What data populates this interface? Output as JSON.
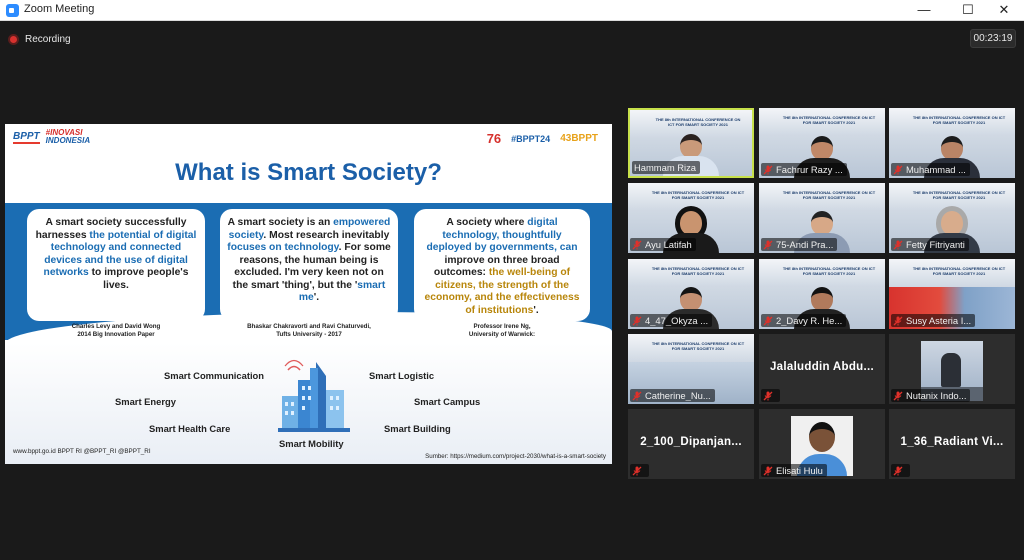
{
  "window": {
    "title": "Zoom Meeting",
    "controls": {
      "minimize": "—",
      "maximize": "☐",
      "close": "✕"
    }
  },
  "meeting": {
    "recording_label": "Recording",
    "elapsed": "00:23:19"
  },
  "slide": {
    "logo_bppt": "BPPT",
    "logo_inovasi_line1": "#INOVASI",
    "logo_inovasi_line2": "INDONESIA",
    "logo_76": "76",
    "logo_bppt24": "#BPPT24",
    "logo_43": "43BPPT",
    "title": "What is Smart Society?",
    "cards": [
      {
        "parts": [
          {
            "t": "A smart society successfully harnesses ",
            "c": ""
          },
          {
            "t": "the potential of digital technology and connected devices and the use of digital networks",
            "c": "hl"
          },
          {
            "t": " to improve people's lives.",
            "c": ""
          }
        ],
        "citation": [
          "Charles Levy and David Wong",
          "2014 Big Innovation Paper"
        ]
      },
      {
        "parts": [
          {
            "t": "A smart society is an ",
            "c": ""
          },
          {
            "t": "empowered society",
            "c": "hl"
          },
          {
            "t": ". Most research inevitably ",
            "c": ""
          },
          {
            "t": "focuses on technology",
            "c": "hl"
          },
          {
            "t": ". For some reasons, the human being is excluded. I'm very keen not on the smart 'thing', but the '",
            "c": ""
          },
          {
            "t": "smart me",
            "c": "hl"
          },
          {
            "t": "'.",
            "c": ""
          }
        ],
        "citation": [
          "Bhaskar Chakravorti and Ravi Chaturvedi,",
          "Tufts University - 2017"
        ]
      },
      {
        "parts": [
          {
            "t": "A society where ",
            "c": ""
          },
          {
            "t": "digital technology, thoughtfully deployed by governments, can",
            "c": "hl"
          },
          {
            "t": " improve on three broad outcomes: ",
            "c": ""
          },
          {
            "t": "the well-being of citizens, the strength of the economy, and the effectiveness of institutions",
            "c": "hl2"
          },
          {
            "t": "'.",
            "c": ""
          }
        ],
        "citation": [
          "Professor Irene Ng,",
          "University of Warwick:"
        ]
      }
    ],
    "applications": [
      "Smart Communication",
      "Smart Logistic",
      "Smart Energy",
      "Smart Campus",
      "Smart Health Care",
      "Smart Building",
      "Smart Mobility"
    ],
    "footer_left": "www.bppt.go.id  BPPT RI  @BPPT_RI  @BPPT_RI",
    "footer_right": "Sumber: https://medium.com/project-2030/what-is-a-smart-society"
  },
  "conference_banner": "THE 8th INTERNATIONAL CONFERENCE ON ICT FOR SMART SOCIETY 2021",
  "participants": [
    "Hammam Riza",
    "Fachrur Razy ...",
    "Muhammad ...",
    "Ayu Latifah",
    "75-Andi Pra...",
    "Fetty Fitriyanti",
    "4_47_Okyza ...",
    "2_Davy R. He...",
    "Susy Asteria I...",
    "Catherine_Nu...",
    "Jalaluddin  Abdu...",
    "Nutanix Indo...",
    "2_100_Dipanjan...",
    "Elisati Hulu",
    "1_36_Radiant  Vi..."
  ],
  "colors": {
    "accent": "#1b6db3",
    "speaking_border": "#c7e04b",
    "mic_muted": "#e0302a",
    "recording": "#d7312e"
  }
}
